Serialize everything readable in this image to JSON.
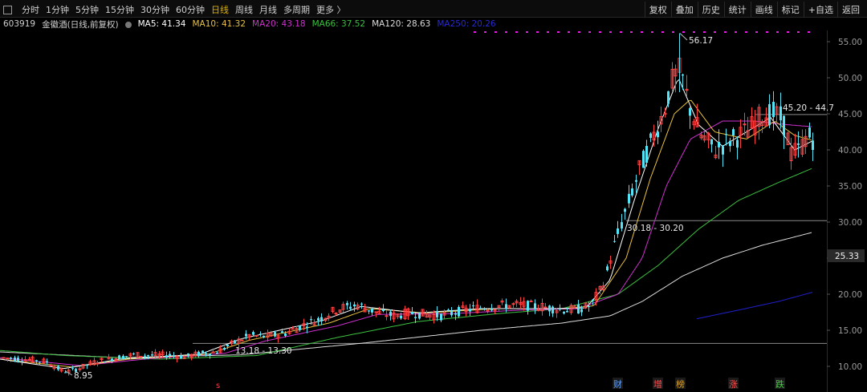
{
  "toolbar": {
    "tabs": [
      "分时",
      "1分钟",
      "5分钟",
      "15分钟",
      "30分钟",
      "60分钟",
      "日线",
      "周线",
      "月线",
      "多周期",
      "更多 〉"
    ],
    "active_tab": "日线",
    "buttons": [
      "复权",
      "叠加",
      "历史",
      "统计",
      "画线",
      "标记",
      "+自选",
      "返回"
    ]
  },
  "stock": {
    "code": "603919",
    "name": "金徽酒(日线,前复权)"
  },
  "ma": {
    "ma5": {
      "label": "MA5: 41.34",
      "color": "#ffffff"
    },
    "ma10": {
      "label": "MA10: 41.32",
      "color": "#e8c040"
    },
    "ma20": {
      "label": "MA20: 43.18",
      "color": "#d030d0"
    },
    "ma66": {
      "label": "MA66: 37.52",
      "color": "#3cc040"
    },
    "ma120": {
      "label": "MA120: 28.63",
      "color": "#dcdcdc"
    },
    "ma250": {
      "label": "MA250: 20.26",
      "color": "#2020d0"
    }
  },
  "colors": {
    "up": "#ff4040",
    "down": "#54e4f8",
    "bg": "#000000",
    "axis": "#808080"
  },
  "chart_data": {
    "type": "candlestick",
    "y_ticks": [
      "55.00",
      "50.00",
      "45.00",
      "40.00",
      "35.00",
      "30.00",
      "25.00",
      "20.00",
      "15.00",
      "10.00"
    ],
    "ylim": [
      9.0,
      57.5
    ],
    "current_price_label": "25.33",
    "annotations": {
      "high": "56.17",
      "low": "8.95",
      "range1": "13.18 - 13.30",
      "range2": "30.18 - 30.20",
      "range3": "45.20 - 44.7"
    },
    "event_markers": [
      {
        "label": "财",
        "color": "#60a0ff"
      },
      {
        "label": "增",
        "color": "#ff5050"
      },
      {
        "label": "榜",
        "color": "#e0a020"
      },
      {
        "label": "涨",
        "color": "#ff5050"
      },
      {
        "label": "跌",
        "color": "#40d040"
      }
    ],
    "bottom_marker": "s",
    "price_anchors": [
      [
        0,
        11.2
      ],
      [
        30,
        11.0
      ],
      [
        60,
        10.6
      ],
      [
        75,
        9.4
      ],
      [
        85,
        9.3
      ],
      [
        100,
        9.8
      ],
      [
        120,
        10.7
      ],
      [
        145,
        11.2
      ],
      [
        165,
        11.6
      ],
      [
        190,
        11.5
      ],
      [
        210,
        11.6
      ],
      [
        230,
        11.3
      ],
      [
        250,
        11.8
      ],
      [
        270,
        12.0
      ],
      [
        290,
        13.2
      ],
      [
        310,
        14.3
      ],
      [
        330,
        14.1
      ],
      [
        355,
        14.6
      ],
      [
        375,
        15.6
      ],
      [
        400,
        16.7
      ],
      [
        420,
        18.0
      ],
      [
        445,
        18.5
      ],
      [
        470,
        17.4
      ],
      [
        490,
        17.0
      ],
      [
        510,
        17.4
      ],
      [
        530,
        17.2
      ],
      [
        550,
        17.0
      ],
      [
        570,
        17.6
      ],
      [
        595,
        18.1
      ],
      [
        620,
        18.4
      ],
      [
        645,
        18.5
      ],
      [
        670,
        18.3
      ],
      [
        690,
        18.0
      ],
      [
        705,
        17.8
      ],
      [
        720,
        17.9
      ],
      [
        735,
        18.4
      ],
      [
        750,
        21.0
      ],
      [
        765,
        27.0
      ],
      [
        780,
        32.0
      ],
      [
        795,
        37.0
      ],
      [
        810,
        41.0
      ],
      [
        825,
        45.0
      ],
      [
        838,
        50.0
      ],
      [
        847,
        51.0
      ],
      [
        858,
        46.0
      ],
      [
        872,
        42.0
      ],
      [
        890,
        40.0
      ],
      [
        910,
        41.5
      ],
      [
        930,
        42.5
      ],
      [
        950,
        45.0
      ],
      [
        965,
        45.0
      ],
      [
        975,
        44.0
      ],
      [
        985,
        39.5
      ],
      [
        995,
        40.0
      ],
      [
        1005,
        42.0
      ],
      [
        1013,
        41.5
      ]
    ],
    "ma_anchors": {
      "ma5": [
        [
          0,
          11.0
        ],
        [
          80,
          9.7
        ],
        [
          150,
          11.0
        ],
        [
          250,
          11.7
        ],
        [
          300,
          13.8
        ],
        [
          400,
          16.3
        ],
        [
          450,
          18.3
        ],
        [
          520,
          17.4
        ],
        [
          600,
          18.0
        ],
        [
          690,
          18.0
        ],
        [
          730,
          18.1
        ],
        [
          760,
          22.0
        ],
        [
          790,
          33.0
        ],
        [
          820,
          43.0
        ],
        [
          845,
          50.0
        ],
        [
          870,
          43.5
        ],
        [
          900,
          40.5
        ],
        [
          930,
          42.5
        ],
        [
          960,
          44.5
        ],
        [
          990,
          40.0
        ],
        [
          1013,
          41.3
        ]
      ],
      "ma10": [
        [
          0,
          11.0
        ],
        [
          90,
          9.9
        ],
        [
          160,
          11.0
        ],
        [
          260,
          11.7
        ],
        [
          310,
          13.6
        ],
        [
          410,
          16.0
        ],
        [
          460,
          18.0
        ],
        [
          530,
          17.4
        ],
        [
          620,
          18.0
        ],
        [
          700,
          18.0
        ],
        [
          740,
          18.4
        ],
        [
          780,
          25.0
        ],
        [
          810,
          36.0
        ],
        [
          840,
          45.0
        ],
        [
          860,
          47.0
        ],
        [
          890,
          42.5
        ],
        [
          930,
          41.5
        ],
        [
          965,
          44.0
        ],
        [
          990,
          42.0
        ],
        [
          1013,
          41.3
        ]
      ],
      "ma20": [
        [
          0,
          11.2
        ],
        [
          100,
          10.1
        ],
        [
          180,
          11.0
        ],
        [
          280,
          11.8
        ],
        [
          330,
          13.5
        ],
        [
          420,
          15.6
        ],
        [
          470,
          17.2
        ],
        [
          560,
          17.3
        ],
        [
          650,
          17.8
        ],
        [
          720,
          18.0
        ],
        [
          770,
          20.0
        ],
        [
          800,
          25.0
        ],
        [
          830,
          35.0
        ],
        [
          860,
          41.5
        ],
        [
          900,
          44.0
        ],
        [
          940,
          44.0
        ],
        [
          980,
          43.5
        ],
        [
          1013,
          43.2
        ]
      ],
      "ma66": [
        [
          0,
          12.2
        ],
        [
          80,
          11.5
        ],
        [
          200,
          11.0
        ],
        [
          320,
          11.5
        ],
        [
          420,
          14.0
        ],
        [
          520,
          16.2
        ],
        [
          620,
          17.3
        ],
        [
          700,
          18.0
        ],
        [
          770,
          20.0
        ],
        [
          820,
          24.0
        ],
        [
          870,
          29.0
        ],
        [
          920,
          33.0
        ],
        [
          970,
          35.5
        ],
        [
          1013,
          37.5
        ]
      ],
      "ma120": [
        [
          0,
          12.0
        ],
        [
          150,
          11.2
        ],
        [
          300,
          11.6
        ],
        [
          450,
          13.2
        ],
        [
          600,
          15.0
        ],
        [
          700,
          16.0
        ],
        [
          760,
          17.0
        ],
        [
          800,
          19.0
        ],
        [
          850,
          22.5
        ],
        [
          900,
          25.0
        ],
        [
          950,
          26.8
        ],
        [
          1013,
          28.6
        ]
      ],
      "ma250": [
        [
          868,
          16.6
        ],
        [
          920,
          17.8
        ],
        [
          970,
          19.0
        ],
        [
          1013,
          20.3
        ]
      ]
    },
    "reference_lines": [
      13.18,
      30.2,
      44.9
    ]
  }
}
